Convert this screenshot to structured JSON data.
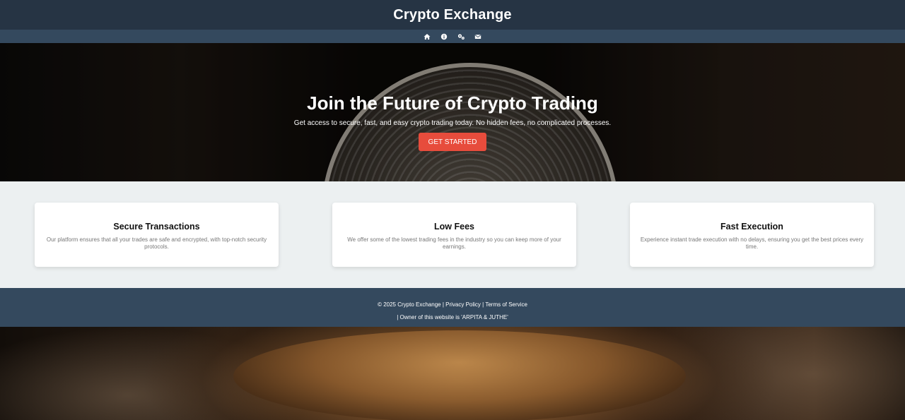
{
  "header": {
    "title": "Crypto Exchange"
  },
  "nav": {
    "items": [
      {
        "icon": "home-icon"
      },
      {
        "icon": "info-icon"
      },
      {
        "icon": "services-icon"
      },
      {
        "icon": "mail-icon"
      }
    ]
  },
  "hero": {
    "title": "Join the Future of Crypto Trading",
    "subtitle": "Get access to secure, fast, and easy crypto trading today. No hidden fees, no complicated processes.",
    "cta_label": "Get Started"
  },
  "features": [
    {
      "title": "Secure Transactions",
      "description": "Our platform ensures that all your trades are safe and encrypted, with top-notch security protocols."
    },
    {
      "title": "Low Fees",
      "description": "We offer some of the lowest trading fees in the industry so you can keep more of your earnings."
    },
    {
      "title": "Fast Execution",
      "description": "Experience instant trade execution with no delays, ensuring you get the best prices every time."
    }
  ],
  "footer": {
    "copyright": "© 2025 Crypto Exchange |",
    "privacy_label": "Privacy Policy",
    "separator": "|",
    "terms_label": "Terms of Service",
    "owner": "| Owner of this website is 'ARPITA & JUTHE'"
  },
  "colors": {
    "header_bg": "#263444",
    "nav_bg": "#34495e",
    "cta_bg": "#e74c3c",
    "features_bg": "#ecf0f1",
    "footer_bg": "#34495e"
  }
}
